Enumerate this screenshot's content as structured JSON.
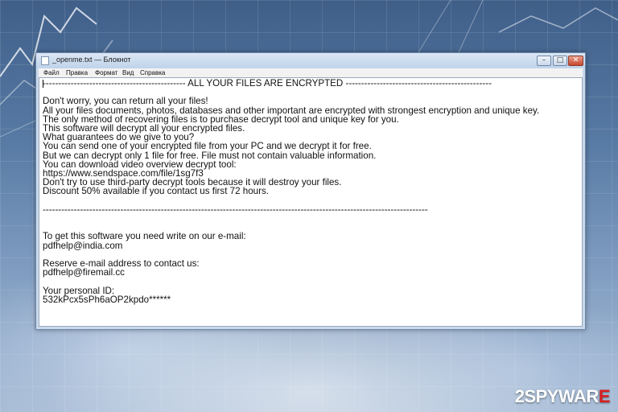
{
  "window": {
    "title": "_openme.txt — Блокнот",
    "icon": "notepad-icon",
    "buttons": {
      "minimize": "–",
      "maximize": "□",
      "close": "✕"
    }
  },
  "menu": [
    {
      "label": "Файл"
    },
    {
      "label": "Правка"
    },
    {
      "label": "Формат"
    },
    {
      "label": "Вид"
    },
    {
      "label": "Справка"
    }
  ],
  "document": {
    "text": "---------------------------------------------- ALL YOUR FILES ARE ENCRYPTED -----------------------------------------------\n\nDon't worry, you can return all your files!\nAll your files documents, photos, databases and other important are encrypted with strongest encryption and unique key.\nThe only method of recovering files is to purchase decrypt tool and unique key for you.\nThis software will decrypt all your encrypted files.\nWhat guarantees do we give to you?\nYou can send one of your encrypted file from your PC and we decrypt it for free.\nBut we can decrypt only 1 file for free. File must not contain valuable information.\nYou can download video overview decrypt tool:\nhttps://www.sendspace.com/file/1sg7f3\nDon't try to use third-party decrypt tools because it will destroy your files.\nDiscount 50% available if you contact us first 72 hours.\n\n----------------------------------------------------------------------------------------------------------------------------\n\n\nTo get this software you need write on our e-mail:\npdfhelp@india.com\n\nReserve e-mail address to contact us:\npdfhelp@firemail.cc\n\nYour personal ID:\n532kPcx5sPh6aOP2kpdo******"
  },
  "watermark": {
    "prefix": "2",
    "brand": "SPYWAR",
    "suffix": "E"
  }
}
